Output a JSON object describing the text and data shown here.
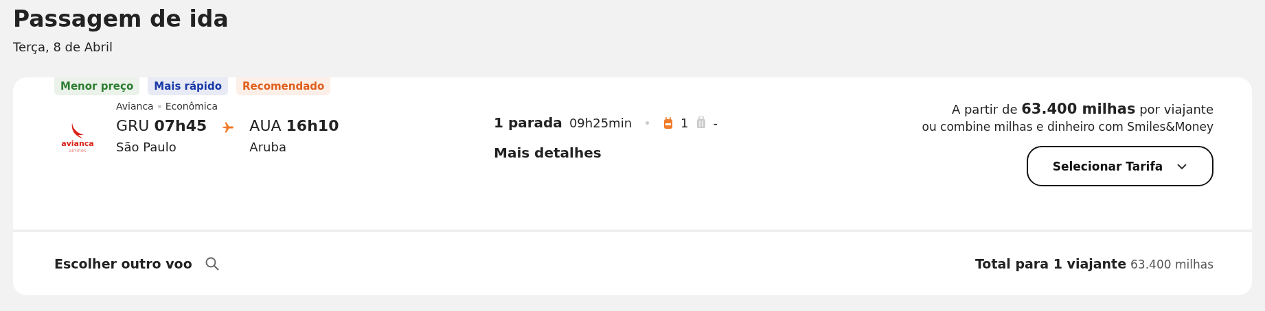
{
  "header": {
    "title": "Passagem de ida",
    "date": "Terça, 8 de Abril"
  },
  "flight": {
    "badges": [
      {
        "label": "Menor preço",
        "color": "#2e7d32"
      },
      {
        "label": "Mais rápido",
        "color": "#1a3aa8"
      },
      {
        "label": "Recomendado",
        "color": "#e0601e"
      }
    ],
    "logo": {
      "name": "avianca",
      "sub": "airlines"
    },
    "airline": "Avianca",
    "cabin": "Econômica",
    "departure": {
      "code": "GRU",
      "time": "07h45",
      "city": "São Paulo"
    },
    "arrival": {
      "code": "AUA",
      "time": "16h10",
      "city": "Aruba"
    },
    "stops": "1 parada",
    "duration": "09h25min",
    "carry_on": "1",
    "checked_bag": "-",
    "details_link": "Mais detalhes",
    "price_line": "A partir de **63.400 milhas**  por viajante",
    "money_line": "ou combine milhas e dinheiro com Smiles&Money",
    "select_button": "Selecionar Tarifa"
  },
  "footer": {
    "other_flight": "Escolher outro voo",
    "total_label": "Total para 1 viajante",
    "total_value": "63.400 milhas"
  }
}
